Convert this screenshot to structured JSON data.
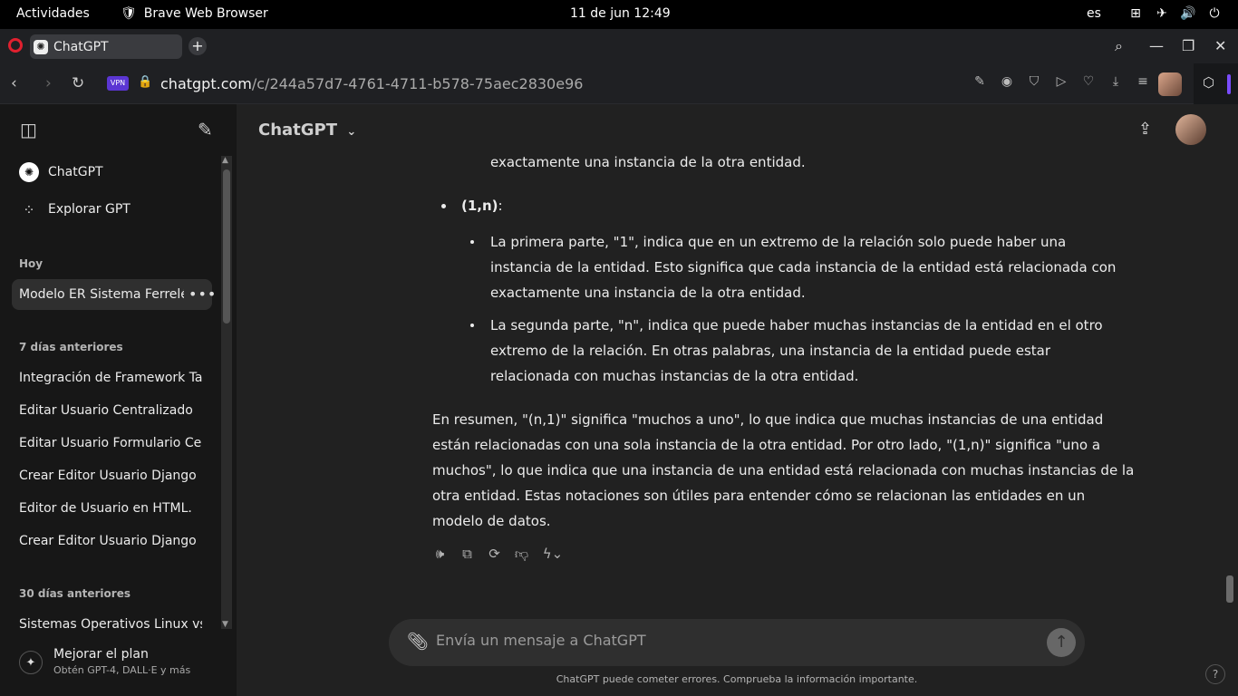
{
  "topbar": {
    "activities": "Actividades",
    "app_name": "Brave Web Browser",
    "clock": "11 de jun  12:49",
    "lang": "es"
  },
  "browser": {
    "tab_title": "ChatGPT",
    "url_domain": "chatgpt.com",
    "url_path": "/c/244a57d7-4761-4711-b578-75aec2830e96",
    "vpn_label": "VPN"
  },
  "sidebar": {
    "top_items": [
      {
        "label": "ChatGPT",
        "icon": "openai-icon"
      },
      {
        "label": "Explorar GPT",
        "icon": "grid-icon"
      }
    ],
    "sections": [
      {
        "heading": "Hoy",
        "items": [
          "Modelo ER Sistema Ferreléctrico"
        ]
      },
      {
        "heading": "7 días anteriores",
        "items": [
          "Integración de Framework Tailwind",
          "Editar Usuario Centralizado",
          "Editar Usuario Formulario Centralizado",
          "Crear Editor Usuario Django",
          "Editor de Usuario en HTML.",
          "Crear Editor Usuario Django"
        ]
      },
      {
        "heading": "30 días anteriores",
        "items": [
          "Sistemas Operativos Linux vs. Windows"
        ]
      }
    ],
    "upgrade_title": "Mejorar el plan",
    "upgrade_subtitle": "Obtén GPT-4, DALL·E y más"
  },
  "main": {
    "model_name": "ChatGPT",
    "message": {
      "line_top": "exactamente una instancia de la otra entidad.",
      "bullet_label": "(1,n)",
      "bullet_colon": ":",
      "sub1": [
        "La primera parte, \"1\", indica que en un extremo de la relación solo puede haber una",
        "instancia de la entidad. Esto significa que cada instancia de la entidad está relacionada con",
        "exactamente una instancia de la otra entidad."
      ],
      "sub2": [
        "La segunda parte, \"n\", indica que puede haber muchas instancias de la entidad en el otro",
        "extremo de la relación. En otras palabras, una instancia de la entidad puede estar",
        "relacionada con muchas instancias de la otra entidad."
      ],
      "summary": [
        "En resumen, \"(n,1)\" significa \"muchos a uno\", lo que indica que muchas instancias de una entidad",
        "están relacionadas con una sola instancia de la otra entidad. Por otro lado, \"(1,n)\" significa \"uno a",
        "muchos\", lo que indica que una instancia de una entidad está relacionada con muchas instancias de la",
        "otra entidad. Estas notaciones son útiles para entender cómo se relacionan las entidades en un",
        "modelo de datos."
      ]
    },
    "composer_placeholder": "Envía un mensaje a ChatGPT",
    "disclaimer": "ChatGPT puede cometer errores. Comprueba la información importante.",
    "help_label": "?"
  }
}
